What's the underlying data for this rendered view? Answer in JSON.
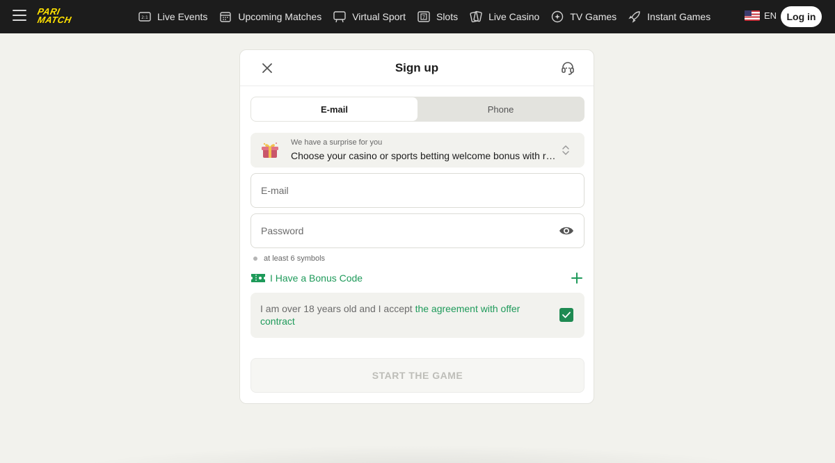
{
  "header": {
    "brand": "PARIMATCH",
    "brand_line1": "PARI",
    "brand_line2": "MATCH",
    "nav": [
      {
        "label": "Live Events",
        "icon": "live-events-icon"
      },
      {
        "label": "Upcoming Matches",
        "icon": "calendar-icon"
      },
      {
        "label": "Virtual Sport",
        "icon": "virtual-sport-icon"
      },
      {
        "label": "Slots",
        "icon": "slots-icon"
      },
      {
        "label": "Live Casino",
        "icon": "cards-icon"
      },
      {
        "label": "TV Games",
        "icon": "tv-games-icon"
      },
      {
        "label": "Instant Games",
        "icon": "rocket-icon"
      }
    ],
    "language": "EN",
    "login_label": "Log in"
  },
  "modal": {
    "title": "Sign up",
    "tabs": [
      {
        "label": "E-mail",
        "active": true
      },
      {
        "label": "Phone",
        "active": false
      }
    ],
    "bonus": {
      "small": "We have a surprise for you",
      "main": "Choose your casino or sports betting welcome bonus with registration"
    },
    "email_placeholder": "E-mail",
    "password_placeholder": "Password",
    "password_hint": "at least 6 symbols",
    "promo_label": "I Have a Bonus Code",
    "agreement": {
      "text": "I am over 18 years old and I accept ",
      "link": "the agreement with offer contract",
      "checked": true
    },
    "submit_label": "START THE GAME"
  },
  "colors": {
    "header_bg": "#1c1c1c",
    "brand_yellow": "#ffe100",
    "accent_green": "#1e9a5a",
    "page_bg": "#f2f2ed"
  }
}
